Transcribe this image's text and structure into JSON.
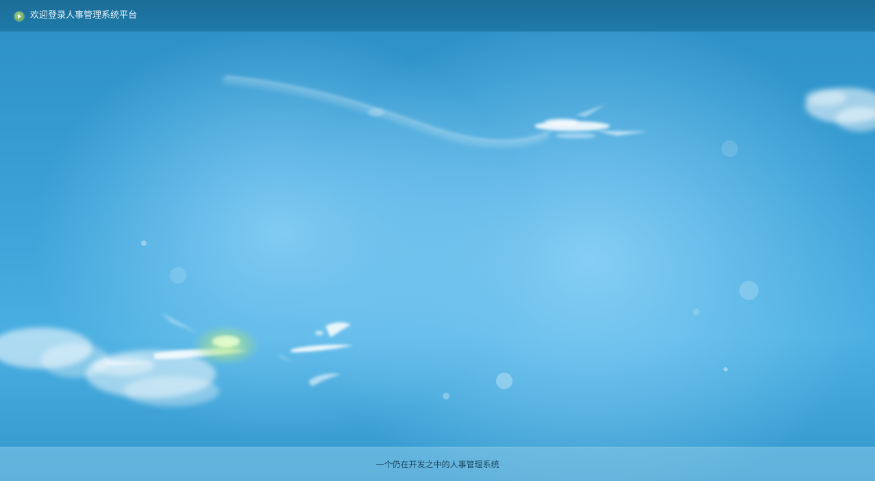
{
  "header": {
    "icon": "play-circle-icon",
    "icon_color": "#7fbf63",
    "title": "欢迎登录人事管理系统平台"
  },
  "footer": {
    "text": "一个仍在开发之中的人事管理系统"
  },
  "colors": {
    "top_bar": "#1b6c96",
    "sky": "#3aa0d6",
    "footer_text": "#1d4561"
  }
}
